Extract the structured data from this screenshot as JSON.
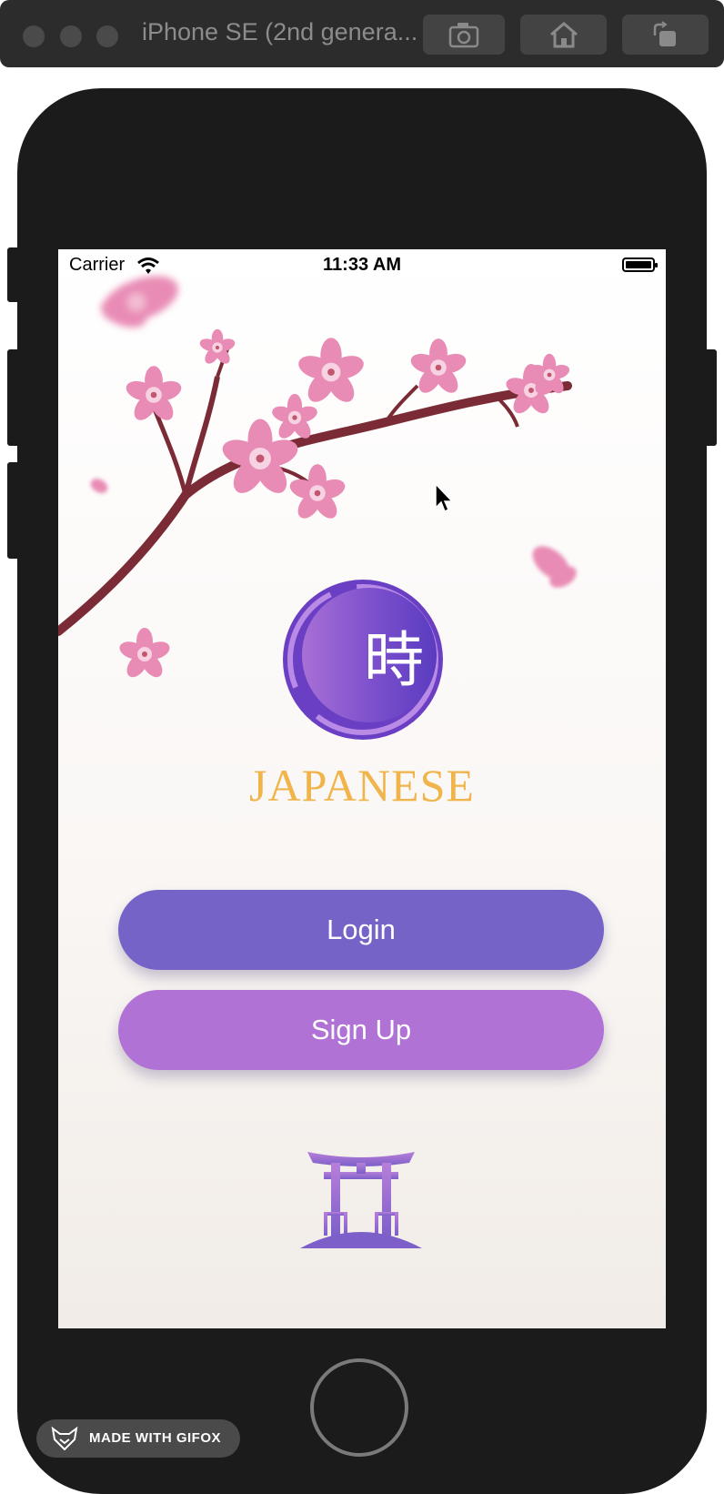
{
  "simulator": {
    "title": "iPhone SE (2nd genera...",
    "toolbar_icons": [
      "camera-icon",
      "home-icon",
      "rotate-icon"
    ]
  },
  "status_bar": {
    "carrier": "Carrier",
    "time": "11:33 AM"
  },
  "app": {
    "logo_kanji": "時",
    "brand_name": "JAPANESE",
    "login_label": "Login",
    "signup_label": "Sign Up"
  },
  "colors": {
    "login_button": "#7663c8",
    "signup_button": "#b172d6",
    "brand_text": "#f0b44a",
    "blossom_pink": "#e98cb5",
    "branch": "#7a2b35"
  },
  "watermark": {
    "label": "MADE WITH GIFOX"
  }
}
